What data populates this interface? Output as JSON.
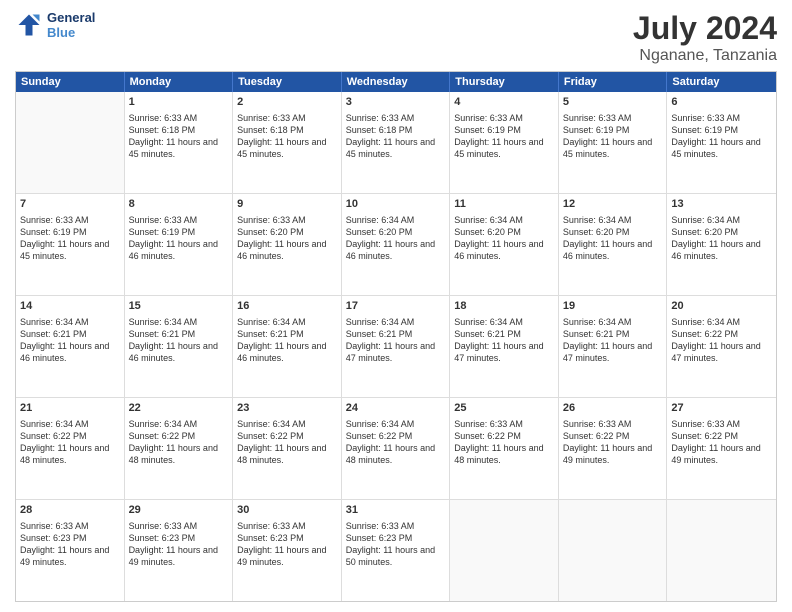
{
  "header": {
    "logo_line1": "General",
    "logo_line2": "Blue",
    "month": "July 2024",
    "location": "Nganane, Tanzania"
  },
  "days_of_week": [
    "Sunday",
    "Monday",
    "Tuesday",
    "Wednesday",
    "Thursday",
    "Friday",
    "Saturday"
  ],
  "weeks": [
    [
      {
        "day": "",
        "sunrise": "",
        "sunset": "",
        "daylight": "",
        "empty": true
      },
      {
        "day": "1",
        "sunrise": "Sunrise: 6:33 AM",
        "sunset": "Sunset: 6:18 PM",
        "daylight": "Daylight: 11 hours and 45 minutes."
      },
      {
        "day": "2",
        "sunrise": "Sunrise: 6:33 AM",
        "sunset": "Sunset: 6:18 PM",
        "daylight": "Daylight: 11 hours and 45 minutes."
      },
      {
        "day": "3",
        "sunrise": "Sunrise: 6:33 AM",
        "sunset": "Sunset: 6:18 PM",
        "daylight": "Daylight: 11 hours and 45 minutes."
      },
      {
        "day": "4",
        "sunrise": "Sunrise: 6:33 AM",
        "sunset": "Sunset: 6:19 PM",
        "daylight": "Daylight: 11 hours and 45 minutes."
      },
      {
        "day": "5",
        "sunrise": "Sunrise: 6:33 AM",
        "sunset": "Sunset: 6:19 PM",
        "daylight": "Daylight: 11 hours and 45 minutes."
      },
      {
        "day": "6",
        "sunrise": "Sunrise: 6:33 AM",
        "sunset": "Sunset: 6:19 PM",
        "daylight": "Daylight: 11 hours and 45 minutes."
      }
    ],
    [
      {
        "day": "7",
        "sunrise": "Sunrise: 6:33 AM",
        "sunset": "Sunset: 6:19 PM",
        "daylight": "Daylight: 11 hours and 45 minutes."
      },
      {
        "day": "8",
        "sunrise": "Sunrise: 6:33 AM",
        "sunset": "Sunset: 6:19 PM",
        "daylight": "Daylight: 11 hours and 46 minutes."
      },
      {
        "day": "9",
        "sunrise": "Sunrise: 6:33 AM",
        "sunset": "Sunset: 6:20 PM",
        "daylight": "Daylight: 11 hours and 46 minutes."
      },
      {
        "day": "10",
        "sunrise": "Sunrise: 6:34 AM",
        "sunset": "Sunset: 6:20 PM",
        "daylight": "Daylight: 11 hours and 46 minutes."
      },
      {
        "day": "11",
        "sunrise": "Sunrise: 6:34 AM",
        "sunset": "Sunset: 6:20 PM",
        "daylight": "Daylight: 11 hours and 46 minutes."
      },
      {
        "day": "12",
        "sunrise": "Sunrise: 6:34 AM",
        "sunset": "Sunset: 6:20 PM",
        "daylight": "Daylight: 11 hours and 46 minutes."
      },
      {
        "day": "13",
        "sunrise": "Sunrise: 6:34 AM",
        "sunset": "Sunset: 6:20 PM",
        "daylight": "Daylight: 11 hours and 46 minutes."
      }
    ],
    [
      {
        "day": "14",
        "sunrise": "Sunrise: 6:34 AM",
        "sunset": "Sunset: 6:21 PM",
        "daylight": "Daylight: 11 hours and 46 minutes."
      },
      {
        "day": "15",
        "sunrise": "Sunrise: 6:34 AM",
        "sunset": "Sunset: 6:21 PM",
        "daylight": "Daylight: 11 hours and 46 minutes."
      },
      {
        "day": "16",
        "sunrise": "Sunrise: 6:34 AM",
        "sunset": "Sunset: 6:21 PM",
        "daylight": "Daylight: 11 hours and 46 minutes."
      },
      {
        "day": "17",
        "sunrise": "Sunrise: 6:34 AM",
        "sunset": "Sunset: 6:21 PM",
        "daylight": "Daylight: 11 hours and 47 minutes."
      },
      {
        "day": "18",
        "sunrise": "Sunrise: 6:34 AM",
        "sunset": "Sunset: 6:21 PM",
        "daylight": "Daylight: 11 hours and 47 minutes."
      },
      {
        "day": "19",
        "sunrise": "Sunrise: 6:34 AM",
        "sunset": "Sunset: 6:21 PM",
        "daylight": "Daylight: 11 hours and 47 minutes."
      },
      {
        "day": "20",
        "sunrise": "Sunrise: 6:34 AM",
        "sunset": "Sunset: 6:22 PM",
        "daylight": "Daylight: 11 hours and 47 minutes."
      }
    ],
    [
      {
        "day": "21",
        "sunrise": "Sunrise: 6:34 AM",
        "sunset": "Sunset: 6:22 PM",
        "daylight": "Daylight: 11 hours and 48 minutes."
      },
      {
        "day": "22",
        "sunrise": "Sunrise: 6:34 AM",
        "sunset": "Sunset: 6:22 PM",
        "daylight": "Daylight: 11 hours and 48 minutes."
      },
      {
        "day": "23",
        "sunrise": "Sunrise: 6:34 AM",
        "sunset": "Sunset: 6:22 PM",
        "daylight": "Daylight: 11 hours and 48 minutes."
      },
      {
        "day": "24",
        "sunrise": "Sunrise: 6:34 AM",
        "sunset": "Sunset: 6:22 PM",
        "daylight": "Daylight: 11 hours and 48 minutes."
      },
      {
        "day": "25",
        "sunrise": "Sunrise: 6:33 AM",
        "sunset": "Sunset: 6:22 PM",
        "daylight": "Daylight: 11 hours and 48 minutes."
      },
      {
        "day": "26",
        "sunrise": "Sunrise: 6:33 AM",
        "sunset": "Sunset: 6:22 PM",
        "daylight": "Daylight: 11 hours and 49 minutes."
      },
      {
        "day": "27",
        "sunrise": "Sunrise: 6:33 AM",
        "sunset": "Sunset: 6:22 PM",
        "daylight": "Daylight: 11 hours and 49 minutes."
      }
    ],
    [
      {
        "day": "28",
        "sunrise": "Sunrise: 6:33 AM",
        "sunset": "Sunset: 6:23 PM",
        "daylight": "Daylight: 11 hours and 49 minutes."
      },
      {
        "day": "29",
        "sunrise": "Sunrise: 6:33 AM",
        "sunset": "Sunset: 6:23 PM",
        "daylight": "Daylight: 11 hours and 49 minutes."
      },
      {
        "day": "30",
        "sunrise": "Sunrise: 6:33 AM",
        "sunset": "Sunset: 6:23 PM",
        "daylight": "Daylight: 11 hours and 49 minutes."
      },
      {
        "day": "31",
        "sunrise": "Sunrise: 6:33 AM",
        "sunset": "Sunset: 6:23 PM",
        "daylight": "Daylight: 11 hours and 50 minutes."
      },
      {
        "day": "",
        "sunrise": "",
        "sunset": "",
        "daylight": "",
        "empty": true
      },
      {
        "day": "",
        "sunrise": "",
        "sunset": "",
        "daylight": "",
        "empty": true
      },
      {
        "day": "",
        "sunrise": "",
        "sunset": "",
        "daylight": "",
        "empty": true
      }
    ]
  ]
}
